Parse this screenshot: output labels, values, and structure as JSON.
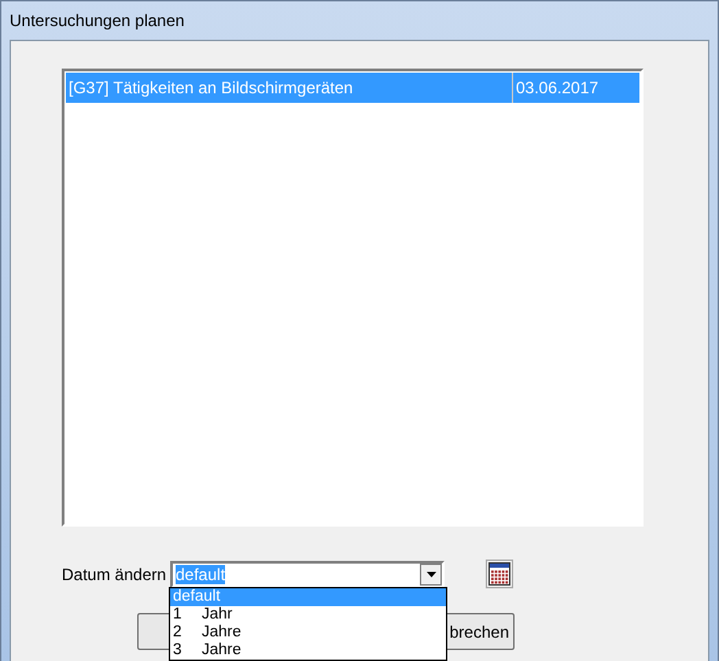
{
  "window": {
    "title": "Untersuchungen planen"
  },
  "list": {
    "rows": [
      {
        "name": "[G37] Tätigkeiten an Bildschirmgeräten",
        "date": "03.06.2017",
        "selected": true
      }
    ]
  },
  "date_change": {
    "label": "Datum ändern",
    "value": "default",
    "expanded": true,
    "options": [
      {
        "label": "default",
        "selected": true
      },
      {
        "number": "1",
        "label": "Jahr",
        "selected": false
      },
      {
        "number": "2",
        "label": "Jahre",
        "selected": false
      },
      {
        "number": "3",
        "label": "Jahre",
        "selected": false
      }
    ]
  },
  "buttons": [
    {
      "kind": "blank"
    },
    {
      "kind": "text",
      "label": "brechen"
    }
  ]
}
